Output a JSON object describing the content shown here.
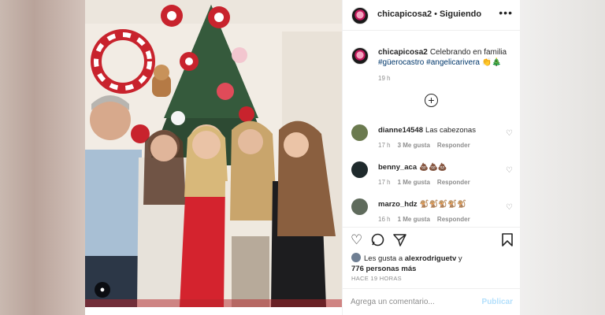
{
  "post": {
    "username": "chicapicosa2",
    "follow_status": "Siguiendo",
    "more_label": "•••",
    "caption_text": "Celebrando en familia",
    "hashtags": [
      "#güerocastro",
      "#angelicarivera"
    ],
    "emoji": "👏🎄",
    "caption_time": "19 h",
    "load_more": "+"
  },
  "comments": [
    {
      "user": "dianne14548",
      "text": "Las cabezonas",
      "time": "17 h",
      "likes": "3 Me gusta",
      "reply": "Responder",
      "avatar_color": "#6b7a4f"
    },
    {
      "user": "benny_aca",
      "text": "💩💩💩",
      "time": "17 h",
      "likes": "1 Me gusta",
      "reply": "Responder",
      "avatar_color": "#1f2a2c"
    },
    {
      "user": "marzo_hdz",
      "text": "🐒🐒🐒🐒🐒",
      "time": "16 h",
      "likes": "1 Me gusta",
      "reply": "Responder",
      "avatar_color": "#5f6b5c"
    }
  ],
  "likes": {
    "prefix": "Les gusta a ",
    "first_user": "alexrodriguetv",
    "middle": " y",
    "count": "776 personas más"
  },
  "age": "HACE 19 HORAS",
  "add_comment": {
    "placeholder": "Agrega un comentario...",
    "post": "Publicar"
  }
}
